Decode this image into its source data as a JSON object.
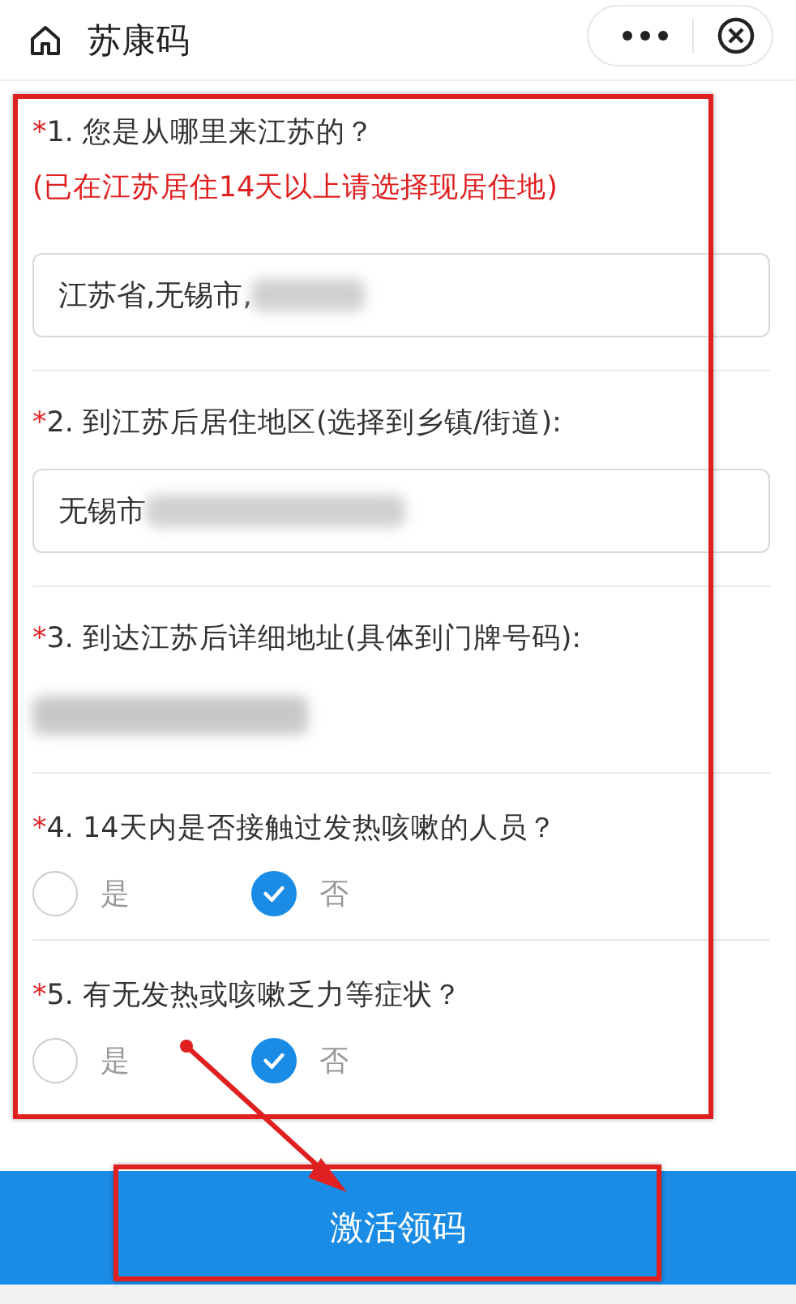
{
  "header": {
    "title": "苏康码"
  },
  "questions": [
    {
      "kind": "select",
      "marker": "*",
      "label": "1. 您是从哪里来江苏的？",
      "hint": "(已在江苏居住14天以上请选择现居住地)",
      "value": "江苏省,无锡市,",
      "redacted": true
    },
    {
      "kind": "select",
      "marker": "*",
      "label": "2. 到江苏后居住地区(选择到乡镇/街道):",
      "value": "无锡市",
      "redacted": true
    },
    {
      "kind": "text",
      "marker": "*",
      "label": "3. 到达江苏后详细地址(具体到门牌号码):",
      "redacted": true
    },
    {
      "kind": "radio",
      "marker": "*",
      "label": "4. 14天内是否接触过发热咳嗽的人员？",
      "options": [
        {
          "label": "是",
          "selected": false
        },
        {
          "label": "否",
          "selected": true
        }
      ]
    },
    {
      "kind": "radio",
      "marker": "*",
      "label": "5. 有无发热或咳嗽乏力等症状？",
      "options": [
        {
          "label": "是",
          "selected": false
        },
        {
          "label": "否",
          "selected": true
        }
      ]
    }
  ],
  "submit": {
    "label": "激活领码"
  },
  "annotations": {
    "highlight_form": true,
    "highlight_button": true,
    "arrow": true
  }
}
